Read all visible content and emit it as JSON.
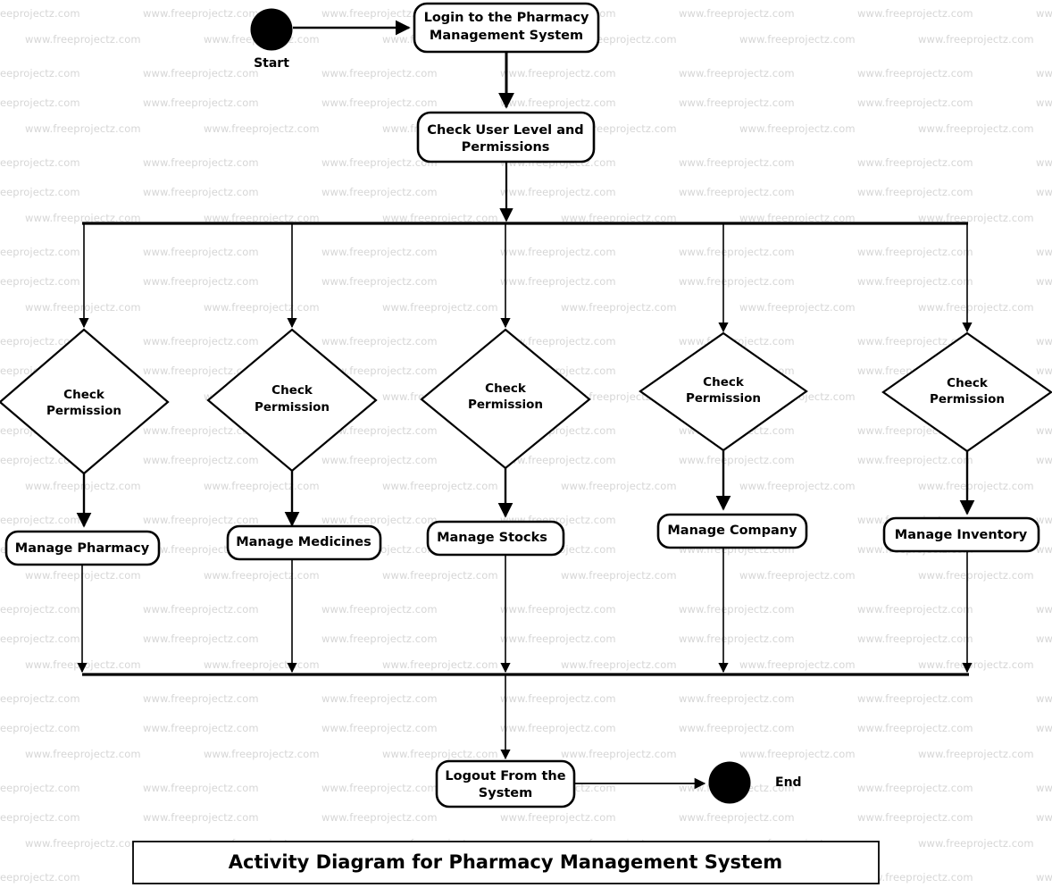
{
  "diagram": {
    "title": "Activity Diagram for Pharmacy Management System",
    "type": "uml-activity-diagram",
    "background_color": "#ffffff",
    "line_color": "#000000",
    "watermark": {
      "text": "www.freeprojectz.com",
      "color": "#d6d6d6"
    },
    "terminals": {
      "start_label": "Start",
      "end_label": "End"
    },
    "activities": {
      "login": "Login to the Pharmacy Management System",
      "check_user": "Check User Level and Permissions",
      "logout": "Logout From the System",
      "manage_pharmacy": "Manage Pharmacy",
      "manage_medicines": "Manage Medicines",
      "manage_stocks": "Manage Stocks",
      "manage_company": "Manage Company",
      "manage_inventory": "Manage Inventory"
    },
    "decisions": {
      "d1_line1": "Check",
      "d1_line2": "Permission",
      "d2_line1": "Check",
      "d2_line2": "Permission",
      "d3_line1": "Check",
      "d3_line2": "Permission",
      "d4_line1": "Check",
      "d4_line2": "Permission",
      "d5_line1": "Check",
      "d5_line2": "Permission"
    },
    "login_lines": {
      "l1": "Login to the Pharmacy",
      "l2": "Management System"
    },
    "check_user_lines": {
      "l1": "Check User Level and",
      "l2": "Permissions"
    },
    "logout_lines": {
      "l1": "Logout From the",
      "l2": "System"
    }
  }
}
